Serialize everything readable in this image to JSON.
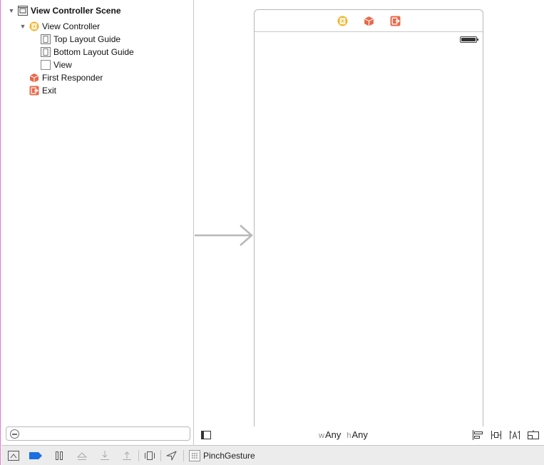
{
  "outline": {
    "scene_title": "View Controller Scene",
    "items": [
      {
        "label": "View Controller",
        "icon": "view-controller-icon"
      },
      {
        "label": "Top Layout Guide",
        "icon": "layout-guide-icon"
      },
      {
        "label": "Bottom Layout Guide",
        "icon": "layout-guide-icon"
      },
      {
        "label": "View",
        "icon": "view-icon"
      },
      {
        "label": "First Responder",
        "icon": "first-responder-icon"
      },
      {
        "label": "Exit",
        "icon": "exit-icon"
      }
    ],
    "filter_placeholder": ""
  },
  "canvas": {
    "dock_icons": [
      "view-controller-icon",
      "first-responder-icon",
      "exit-icon"
    ]
  },
  "size_class": {
    "w_prefix": "w",
    "w_value": "Any",
    "h_prefix": "h",
    "h_value": "Any"
  },
  "debug_bar": {
    "gesture_label": "PinchGesture"
  },
  "colors": {
    "view_controller_yellow": "#f0b429",
    "responder_orange": "#e8694a",
    "breakpoint_blue": "#1d6fe0",
    "sidebar_edge": "#e07ad0"
  }
}
